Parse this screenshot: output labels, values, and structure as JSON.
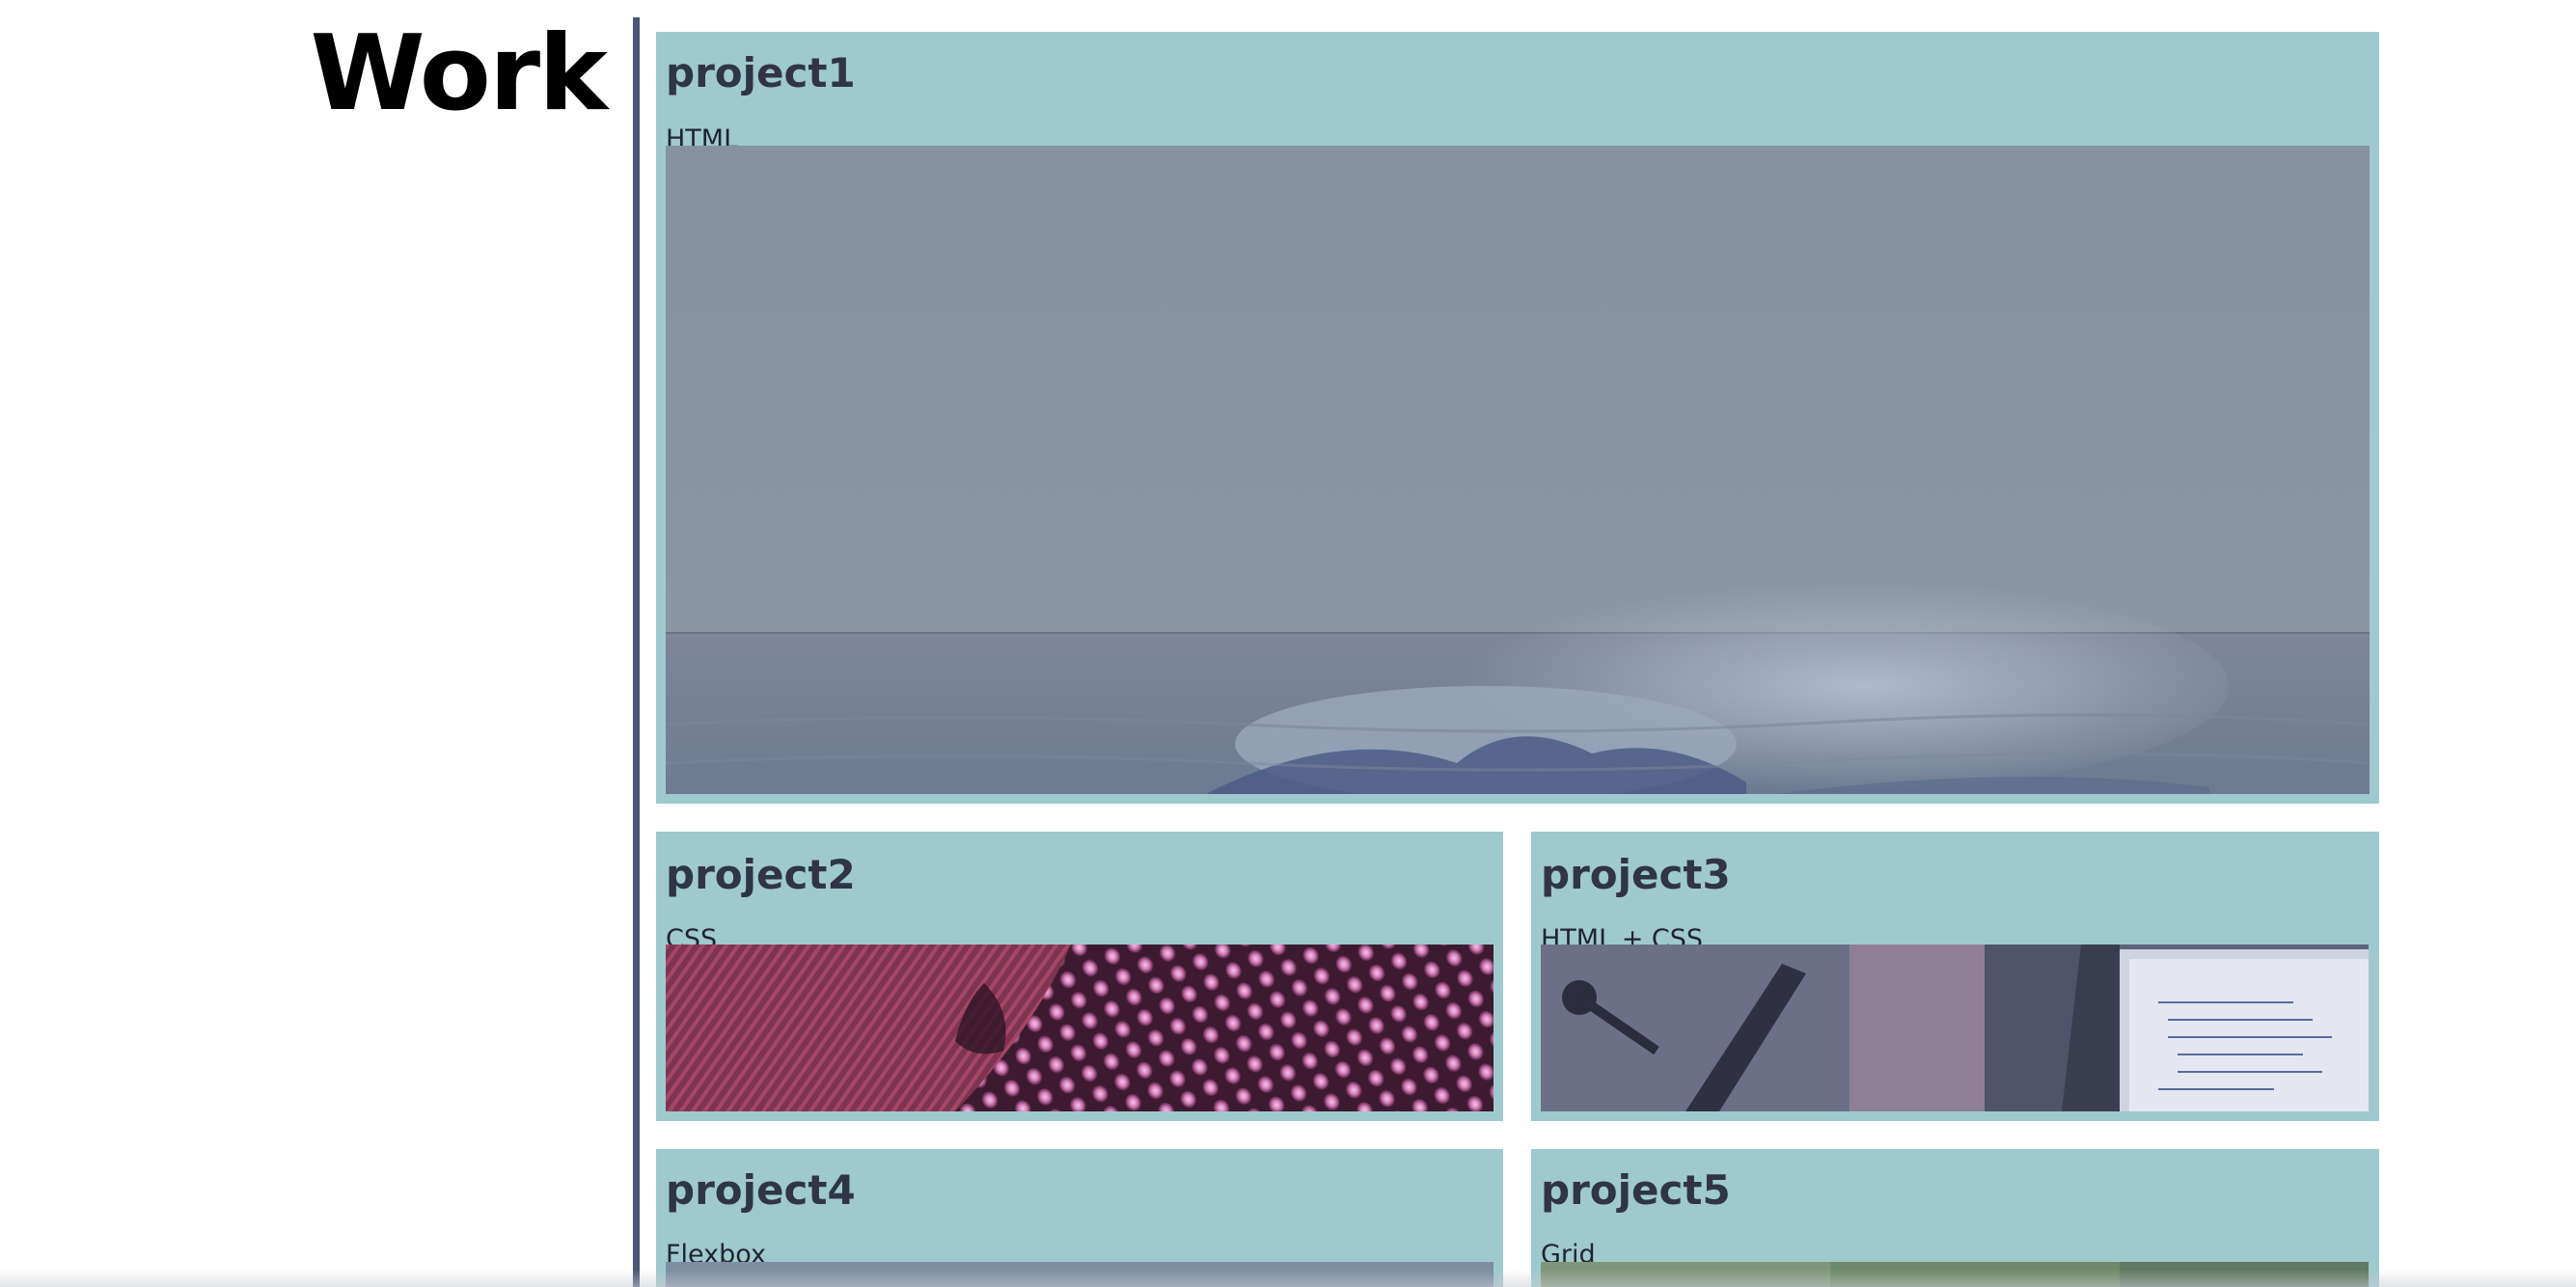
{
  "section": {
    "heading": "Work"
  },
  "projects": [
    {
      "title": "project1",
      "tag": "HTML",
      "image": "ocean-wave-photo"
    },
    {
      "title": "project2",
      "tag": "CSS",
      "image": "led-lights-photo"
    },
    {
      "title": "project3",
      "tag": "HTML + CSS",
      "image": "code-laptop-photo"
    },
    {
      "title": "project4",
      "tag": "Flexbox",
      "image": "landscape-photo"
    },
    {
      "title": "project5",
      "tag": "Grid",
      "image": "greenery-photo"
    }
  ],
  "colors": {
    "card_background": "#9ecacd",
    "divider": "#4b5576",
    "title_text": "#2f3546"
  }
}
